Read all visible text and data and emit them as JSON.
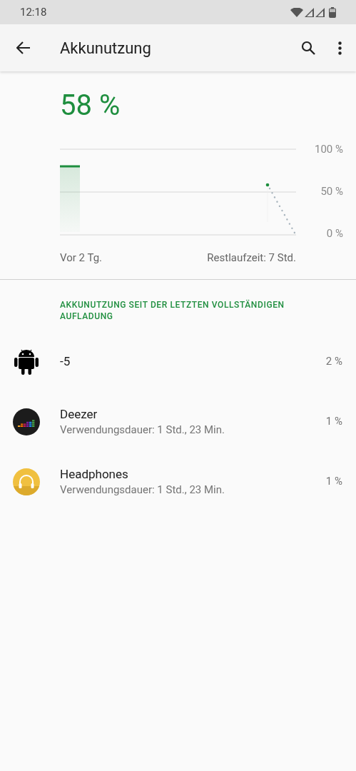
{
  "status_bar": {
    "time": "12:18"
  },
  "app_bar": {
    "title": "Akkunutzung"
  },
  "battery": {
    "percent": "58 %",
    "axis_labels": [
      "100 %",
      "50 %",
      "0 %"
    ],
    "start_label": "Vor 2 Tg.",
    "end_label": "Restlaufzeit: 7 Std."
  },
  "section": {
    "header": "AKKUNUTZUNG SEIT DER LETZTEN VOLLSTÄNDIGEN AUFLADUNG",
    "apps": [
      {
        "kind": "android",
        "name": "-5",
        "usage": "2 %"
      },
      {
        "kind": "deezer",
        "name": "Deezer",
        "subtitle": "Verwendungsdauer: 1 Std., 23 Min.",
        "usage": "1 %"
      },
      {
        "kind": "headphones",
        "name": "Headphones",
        "subtitle": "Verwendungsdauer: 1 Std., 23 Min.",
        "usage": "1 %"
      }
    ]
  }
}
